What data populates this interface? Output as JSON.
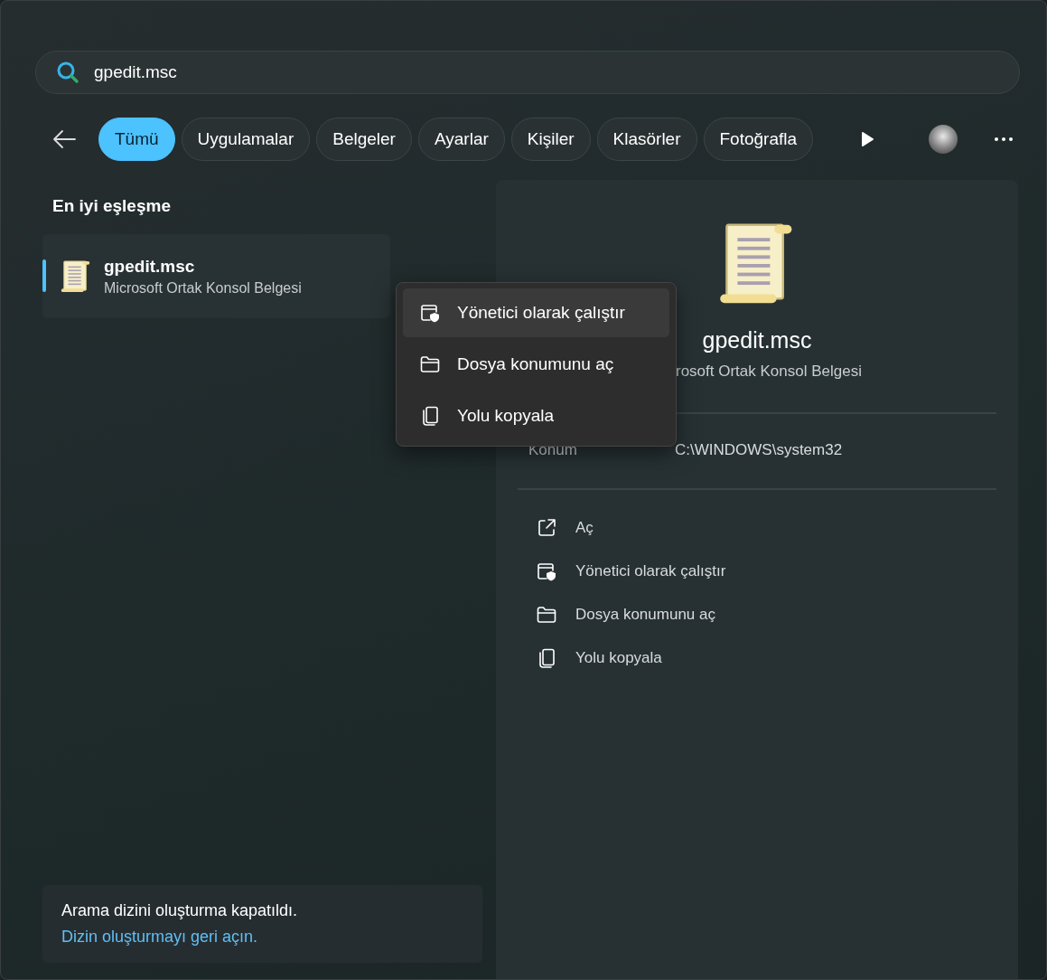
{
  "search": {
    "value": "gpedit.msc"
  },
  "filters": [
    {
      "label": "Tümü",
      "selected": true
    },
    {
      "label": "Uygulamalar",
      "selected": false
    },
    {
      "label": "Belgeler",
      "selected": false
    },
    {
      "label": "Ayarlar",
      "selected": false
    },
    {
      "label": "Kişiler",
      "selected": false
    },
    {
      "label": "Klasörler",
      "selected": false
    },
    {
      "label": "Fotoğrafla",
      "selected": false
    }
  ],
  "best_match": {
    "heading": "En iyi eşleşme",
    "result": {
      "name": "gpedit.msc",
      "type": "Microsoft Ortak Konsol Belgesi",
      "selected": true
    }
  },
  "details": {
    "name": "gpedit.msc",
    "type": "rosoft Ortak Konsol Belgesi",
    "location_label": "Konum",
    "location_value": "C:\\WINDOWS\\system32",
    "actions": [
      {
        "kind": "open",
        "label": "Aç"
      },
      {
        "kind": "admin",
        "label": "Yönetici olarak çalıştır"
      },
      {
        "kind": "folder",
        "label": "Dosya konumunu aç"
      },
      {
        "kind": "copy",
        "label": "Yolu kopyala"
      }
    ]
  },
  "context_menu": [
    {
      "kind": "admin",
      "label": "Yönetici olarak çalıştır",
      "selected": true
    },
    {
      "kind": "folder",
      "label": "Dosya konumunu aç",
      "selected": false
    },
    {
      "kind": "copy",
      "label": "Yolu kopyala",
      "selected": false
    }
  ],
  "notice": {
    "message": "Arama dizini oluşturma kapatıldı.",
    "link": "Dizin oluşturmayı geri açın."
  }
}
